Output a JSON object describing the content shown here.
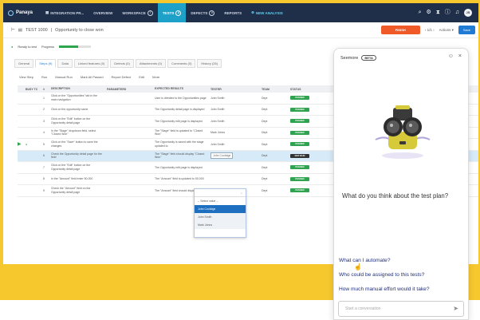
{
  "topbar": {
    "logo": "Panaya",
    "nav": [
      {
        "label": "INTEGRATION PR..."
      },
      {
        "label": "OVERVIEW"
      },
      {
        "label": "WORKSPACE",
        "badge": "7"
      },
      {
        "label": "TESTS",
        "badge": "3",
        "active": true
      },
      {
        "label": "DEFECTS",
        "badge": "0"
      },
      {
        "label": "REPORTS"
      },
      {
        "label": "NEW ANALYSIS"
      }
    ],
    "avatar_initials": "JS"
  },
  "breadcrumb": {
    "test_id": "TEST 1000",
    "title": "Opportunity to close won",
    "finish_label": "FINISH",
    "pager": "1/1",
    "actions_label": "Actions",
    "save_label": "Save"
  },
  "status": {
    "ready_label": "Ready to test",
    "progress_label": "Progress",
    "progress_fraction": 0.6
  },
  "tabs": [
    "General",
    "Steps (9)",
    "Data",
    "Linked features (0)",
    "Defects (0)",
    "Attachments (0)",
    "Comments (0)",
    "History (26)"
  ],
  "toolbar": [
    "View Step",
    "Run",
    "Manual Run",
    "Mark All Passed",
    "Report Defect",
    "Edit",
    "More"
  ],
  "grid": {
    "headers": [
      "",
      "BUSY TC",
      "#",
      "DESCRIPTION",
      "PARAMETERS",
      "EXPECTED RESULTS",
      "TESTER",
      "TEAM",
      "STATUS",
      "ACTUAL"
    ],
    "rows": [
      {
        "num": "1",
        "desc": "Click on the \"Opportunities\" tab in the main navigation",
        "exp": "User is directed to the Opportunities page",
        "tester": "John Smith",
        "team": "Dept",
        "status": "PASSED"
      },
      {
        "num": "2",
        "desc": "Click on the opportunity name",
        "exp": "The Opportunity detail page is displayed",
        "tester": "John Smith",
        "team": "Dept",
        "status": "PASSED"
      },
      {
        "num": "3",
        "desc": "Click on the \"Edit\" button on the Opportunity detail page",
        "exp": "The Opportunity edit page is displayed",
        "tester": "John Smith",
        "team": "Dept",
        "status": "PASSED"
      },
      {
        "num": "4",
        "desc": "In the \"Stage\" dropdown field, select \"Closed Won\"",
        "exp": "The \"Stage\" field is updated to \"Closed Won\"",
        "tester": "Mark Johns",
        "team": "Dept",
        "status": "PASSED"
      },
      {
        "num": "5",
        "desc": "Click on the \"Save\" button to save the changes",
        "exp": "The Opportunity is saved with the stage updated to",
        "tester": "John Smith",
        "team": "Dept",
        "status": "PASSED"
      },
      {
        "num": "6",
        "desc": "Check the Opportunity detail page for the field",
        "exp": "The \"Stage\" field should display \"Closed Won\"",
        "tester": "John Coolidge",
        "team": "Dept",
        "status": "NOT RUN",
        "selected": true
      },
      {
        "num": "7",
        "desc": "Click on the \"Edit\" button on the Opportunity detail page",
        "exp": "The Opportunity edit page is displayed",
        "tester": "",
        "team": "Dept",
        "status": "PASSED"
      },
      {
        "num": "8",
        "desc": "In the \"Amount\" field enter 50,000",
        "exp": "The \"Amount\" field is updated to 50,000",
        "tester": "",
        "team": "Dept",
        "status": "PASSED"
      },
      {
        "num": "9",
        "desc": "Check the \"Amount\" field on the Opportunity detail page",
        "exp": "The \"Amount\" field should display 50,000",
        "tester": "",
        "team": "Dept",
        "status": "PASSED"
      }
    ]
  },
  "dropdown": {
    "select_label": "-- Select value --",
    "options": [
      "John Coolidge",
      "John Smith",
      "Mark Johns"
    ]
  },
  "assistant": {
    "name": "Seemore",
    "beta": "BETA",
    "question": "What do you think about the test plan?",
    "suggestions": [
      "What can I automate?",
      "Who could be assigned to this tests?",
      "How much manual effort would it take?"
    ],
    "input_placeholder": "Start a conversation"
  },
  "colors": {
    "background": "#f7c82e",
    "topbar": "#1f2f4a",
    "active_tab": "#1da1c8",
    "passed": "#2ea44f",
    "finish": "#f05a28"
  }
}
